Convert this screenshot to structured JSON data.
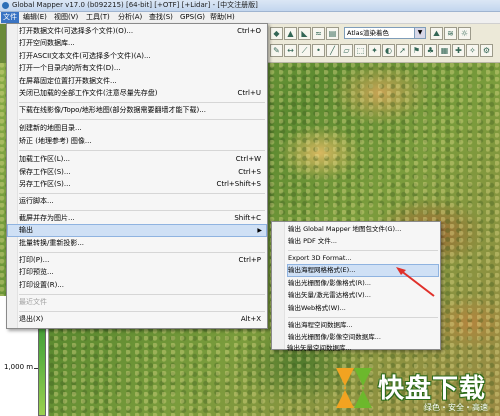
{
  "window": {
    "title": "Global Mapper v17.0 (b092215) [64-bit] [+OTF] [+Lidar] - [中文注册版]"
  },
  "menubar": [
    {
      "label": "文件",
      "active": true
    },
    {
      "label": "编辑(E)"
    },
    {
      "label": "视图(V)"
    },
    {
      "label": "工具(T)"
    },
    {
      "label": "分析(A)"
    },
    {
      "label": "查找(S)"
    },
    {
      "label": "GPS(G)"
    },
    {
      "label": "帮助(H)"
    }
  ],
  "toolbar": {
    "shader_value": "Atlas渲染着色"
  },
  "file_menu": {
    "items": [
      {
        "label": "打开数据文件(可选择多个文件)(O)...",
        "shortcut": "Ctrl+O"
      },
      {
        "label": "打开空间数据库..."
      },
      {
        "label": "打开ASCII文本文件(可选择多个文件)(A)..."
      },
      {
        "label": "打开一个目录内的所有文件(D)..."
      },
      {
        "label": "在屏幕固定位置打开数据文件..."
      },
      {
        "label": "关闭已加载的全部工作文件(注意尽量先存盘)",
        "shortcut": "Ctrl+U"
      },
      {
        "label": "下载在线影像/Topo/地形地图(部分数据需要翻墙才能下载)..."
      },
      {
        "label": "创建新的地图目录..."
      },
      {
        "label": "矫正 (地理参考) 图像..."
      },
      {
        "label": "加载工作区(L)...",
        "shortcut": "Ctrl+W"
      },
      {
        "label": "保存工作区(S)...",
        "shortcut": "Ctrl+S"
      },
      {
        "label": "另存工作区(S)...",
        "shortcut": "Ctrl+Shift+S"
      },
      {
        "label": "运行脚本..."
      },
      {
        "label": "截屏并存为图片...",
        "shortcut": "Shift+C"
      },
      {
        "label": "输出"
      },
      {
        "label": "批量转换/重新投影..."
      },
      {
        "label": "打印(P)...",
        "shortcut": "Ctrl+P"
      },
      {
        "label": "打印预览..."
      },
      {
        "label": "打印设置(R)..."
      },
      {
        "label": "最近文件"
      },
      {
        "label": "退出(X)",
        "shortcut": "Alt+X"
      }
    ]
  },
  "export_submenu": {
    "items": [
      {
        "label": "输出 Global Mapper 地图包文件(G)..."
      },
      {
        "label": "输出 PDF 文件..."
      },
      {
        "label": "Export 3D Format..."
      },
      {
        "label": "输出海程网格格式(E)..."
      },
      {
        "label": "输出光栅图像/影像格式(R)..."
      },
      {
        "label": "输出矢量/激光雷达格式(V)..."
      },
      {
        "label": "输出Web格式(W)..."
      },
      {
        "label": "输出海程空间数据库..."
      },
      {
        "label": "输出光栅图像/影像空间数据库..."
      },
      {
        "label": "输出矢量空间数据库..."
      }
    ]
  },
  "legend": {
    "elevation_label": "1,000 m"
  },
  "watermark": {
    "brand": "快盘下载",
    "slogan": "绿色・安全・高速"
  }
}
